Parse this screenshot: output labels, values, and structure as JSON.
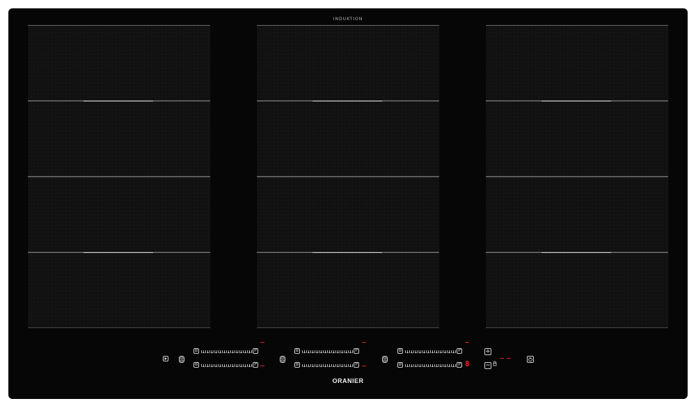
{
  "hob": {
    "top_label": "INDUKTION",
    "brand": "ORANIER",
    "colors": {
      "surface": "#060606",
      "zone": "#222222",
      "indicator": "#e52222"
    }
  },
  "zones": {
    "columns": 3,
    "rows": 4
  },
  "controls": {
    "play_icon": "play-icon",
    "bridge_icon": "bridge-icon",
    "slider_start_label": "B",
    "slider_end_label": "P",
    "plus_label": "+",
    "minus_label": "−",
    "timer_digit": "8",
    "power_icon": "power-icon",
    "lock_icon": "lock-icon"
  }
}
